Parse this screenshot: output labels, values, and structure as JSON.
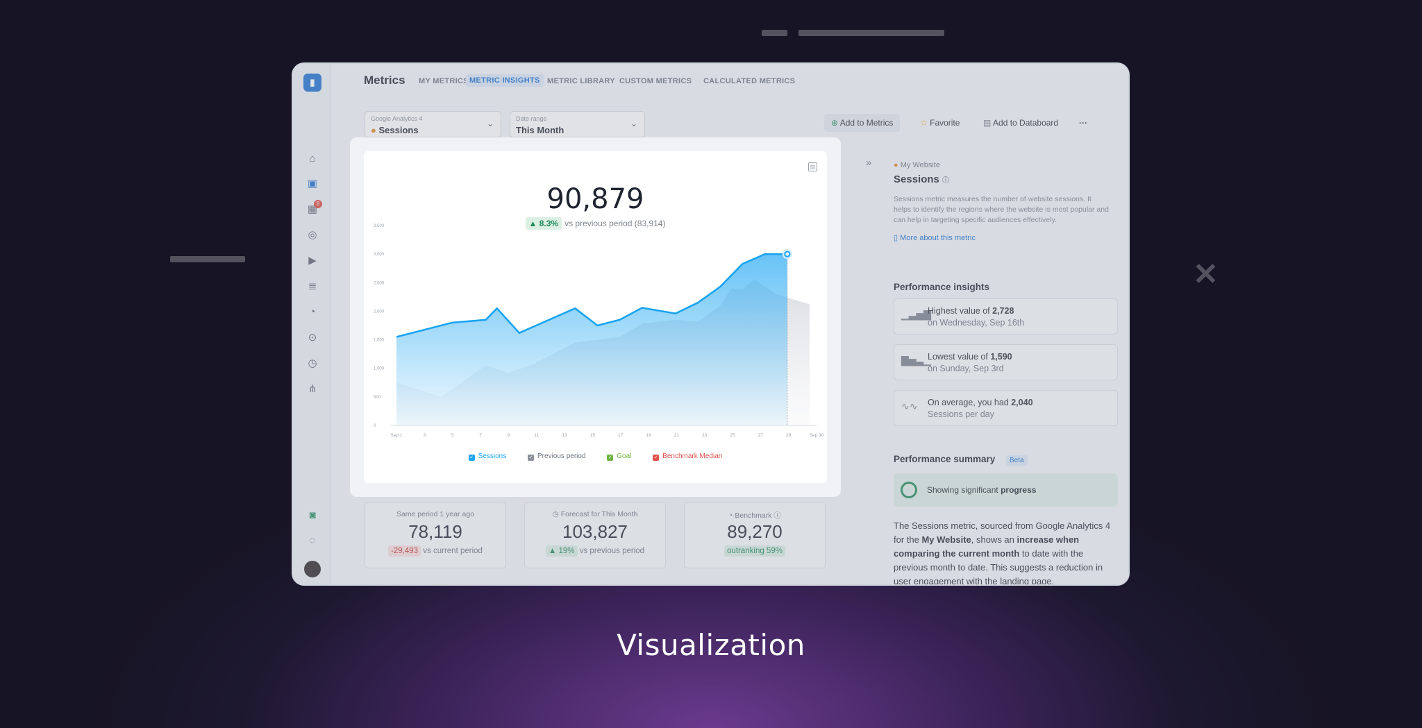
{
  "caption": "Visualization",
  "app": {
    "title": "Metrics",
    "tabs": [
      "MY METRICS",
      "METRIC INSIGHTS",
      "METRIC LIBRARY",
      "CUSTOM METRICS",
      "CALCULATED METRICS"
    ],
    "active_tab": "METRIC INSIGHTS",
    "sidebar_badge": "8"
  },
  "selectors": {
    "source_label": "Google Analytics 4",
    "source_value": "Sessions",
    "date_label": "Date range",
    "date_value": "This Month"
  },
  "actions": {
    "add_to_metrics": "Add to Metrics",
    "favorite": "Favorite",
    "add_to_databoard": "Add to Databoard",
    "more": "···"
  },
  "panel": {
    "source": "My Website",
    "title": "Sessions",
    "description": "Sessions metric measures the number of website sessions. It helps to identify the regions where the website is most popular and can help in targeting specific audiences effectively.",
    "link": "More about this metric",
    "insights_heading": "Performance insights",
    "insights": [
      {
        "line1_prefix": "Highest value of ",
        "line1_value": "2,728",
        "line2": "on Wednesday, Sep 16th"
      },
      {
        "line1_prefix": "Lowest value of ",
        "line1_value": "1,590",
        "line2": "on Sunday, Sep 3rd"
      },
      {
        "line1_prefix": "On average, you had ",
        "line1_value": "2,040",
        "line2": "Sessions per day"
      }
    ],
    "summary_heading": "Performance summary",
    "summary_badge": "Beta",
    "progress_prefix": "Showing significant ",
    "progress_word": "progress",
    "summary_parts": [
      "The Sessions metric, sourced from Google Analytics 4 for the ",
      "My Website",
      ", shows an ",
      "increase when comparing the current month",
      " to date with the previous month to date. This suggests a reduction in user engagement with the landing page."
    ]
  },
  "kpis": [
    {
      "title": "Same period 1 year ago",
      "value": "78,119",
      "delta": "-29,493",
      "delta_text": "vs current period"
    },
    {
      "title": "Forecast for This Month",
      "value": "103,827",
      "delta": "▲ 19%",
      "delta_text": "vs previous period"
    },
    {
      "title": "Benchmark",
      "value": "89,270",
      "delta": "outranking 59%",
      "delta_text": ""
    }
  ],
  "modal": {
    "value": "90,879",
    "delta": "▲ 8.3%",
    "comparison": "vs previous period (83,914)"
  },
  "colors": {
    "sessions": "#1aa3f0",
    "previous": "#8a8f99",
    "goal": "#6db33f",
    "benchmark": "#e0504a"
  },
  "chart_data": {
    "type": "area",
    "x_ticks": [
      "Sep 1",
      "3",
      "5",
      "7",
      "9",
      "11",
      "13",
      "15",
      "17",
      "19",
      "21",
      "23",
      "25",
      "27",
      "29",
      "Sep 30"
    ],
    "ylim": [
      0,
      3500
    ],
    "y_ticks": [
      "0",
      "500",
      "1,000",
      "1,500",
      "2,000",
      "2,500",
      "3,000",
      "3,500"
    ],
    "grid": false,
    "legend_position": "bottom",
    "series": [
      {
        "name": "Sessions",
        "x": [
          1,
          6,
          9,
          10,
          12,
          17,
          19,
          21,
          23,
          26,
          28,
          30,
          32,
          34,
          36
        ],
        "values": [
          1550,
          1800,
          1850,
          2050,
          1620,
          2050,
          1750,
          1850,
          2060,
          1960,
          2150,
          2430,
          2830,
          3000,
          3000
        ]
      },
      {
        "name": "Previous period",
        "x": [
          1,
          5,
          9,
          11,
          13,
          17,
          21,
          23,
          26,
          28,
          30,
          31,
          32,
          33,
          35,
          38
        ],
        "values": [
          750,
          500,
          1050,
          920,
          1050,
          1450,
          1550,
          1780,
          1850,
          1820,
          2100,
          2400,
          2380,
          2560,
          2300,
          2120
        ]
      }
    ],
    "legend": [
      "Sessions",
      "Previous period",
      "Goal",
      "Benchmark Median"
    ]
  }
}
